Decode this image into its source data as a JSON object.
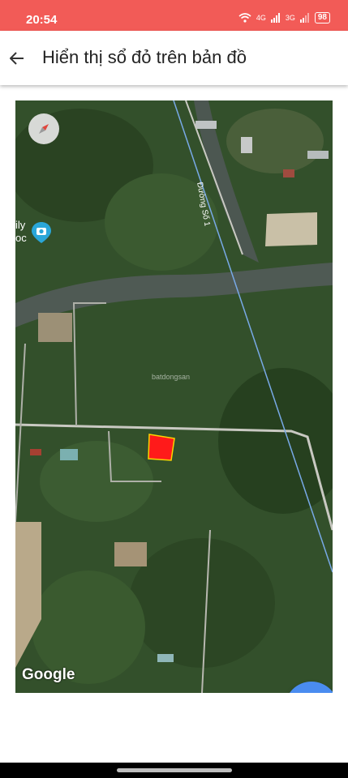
{
  "status_bar": {
    "time": "20:54",
    "signal_1": "4G",
    "signal_2": "3G",
    "battery": "98"
  },
  "app_bar": {
    "title": "Hiển thị sổ đỏ trên bản đồ",
    "back_icon": "arrow-left-icon"
  },
  "map": {
    "poi_label_line1": "ily",
    "poi_label_line2": "oc",
    "road_label": "Đường Số 1",
    "watermark": "batdongsan",
    "attribution": "Google",
    "parcel_color": "#ff1a1a",
    "compass_icon": "compass-icon",
    "fab_icon": "triangle-up-icon",
    "fab_color": "#4a8cf0"
  },
  "colors": {
    "status_bar": "#f25b57",
    "accent": "#4a8cf0"
  }
}
